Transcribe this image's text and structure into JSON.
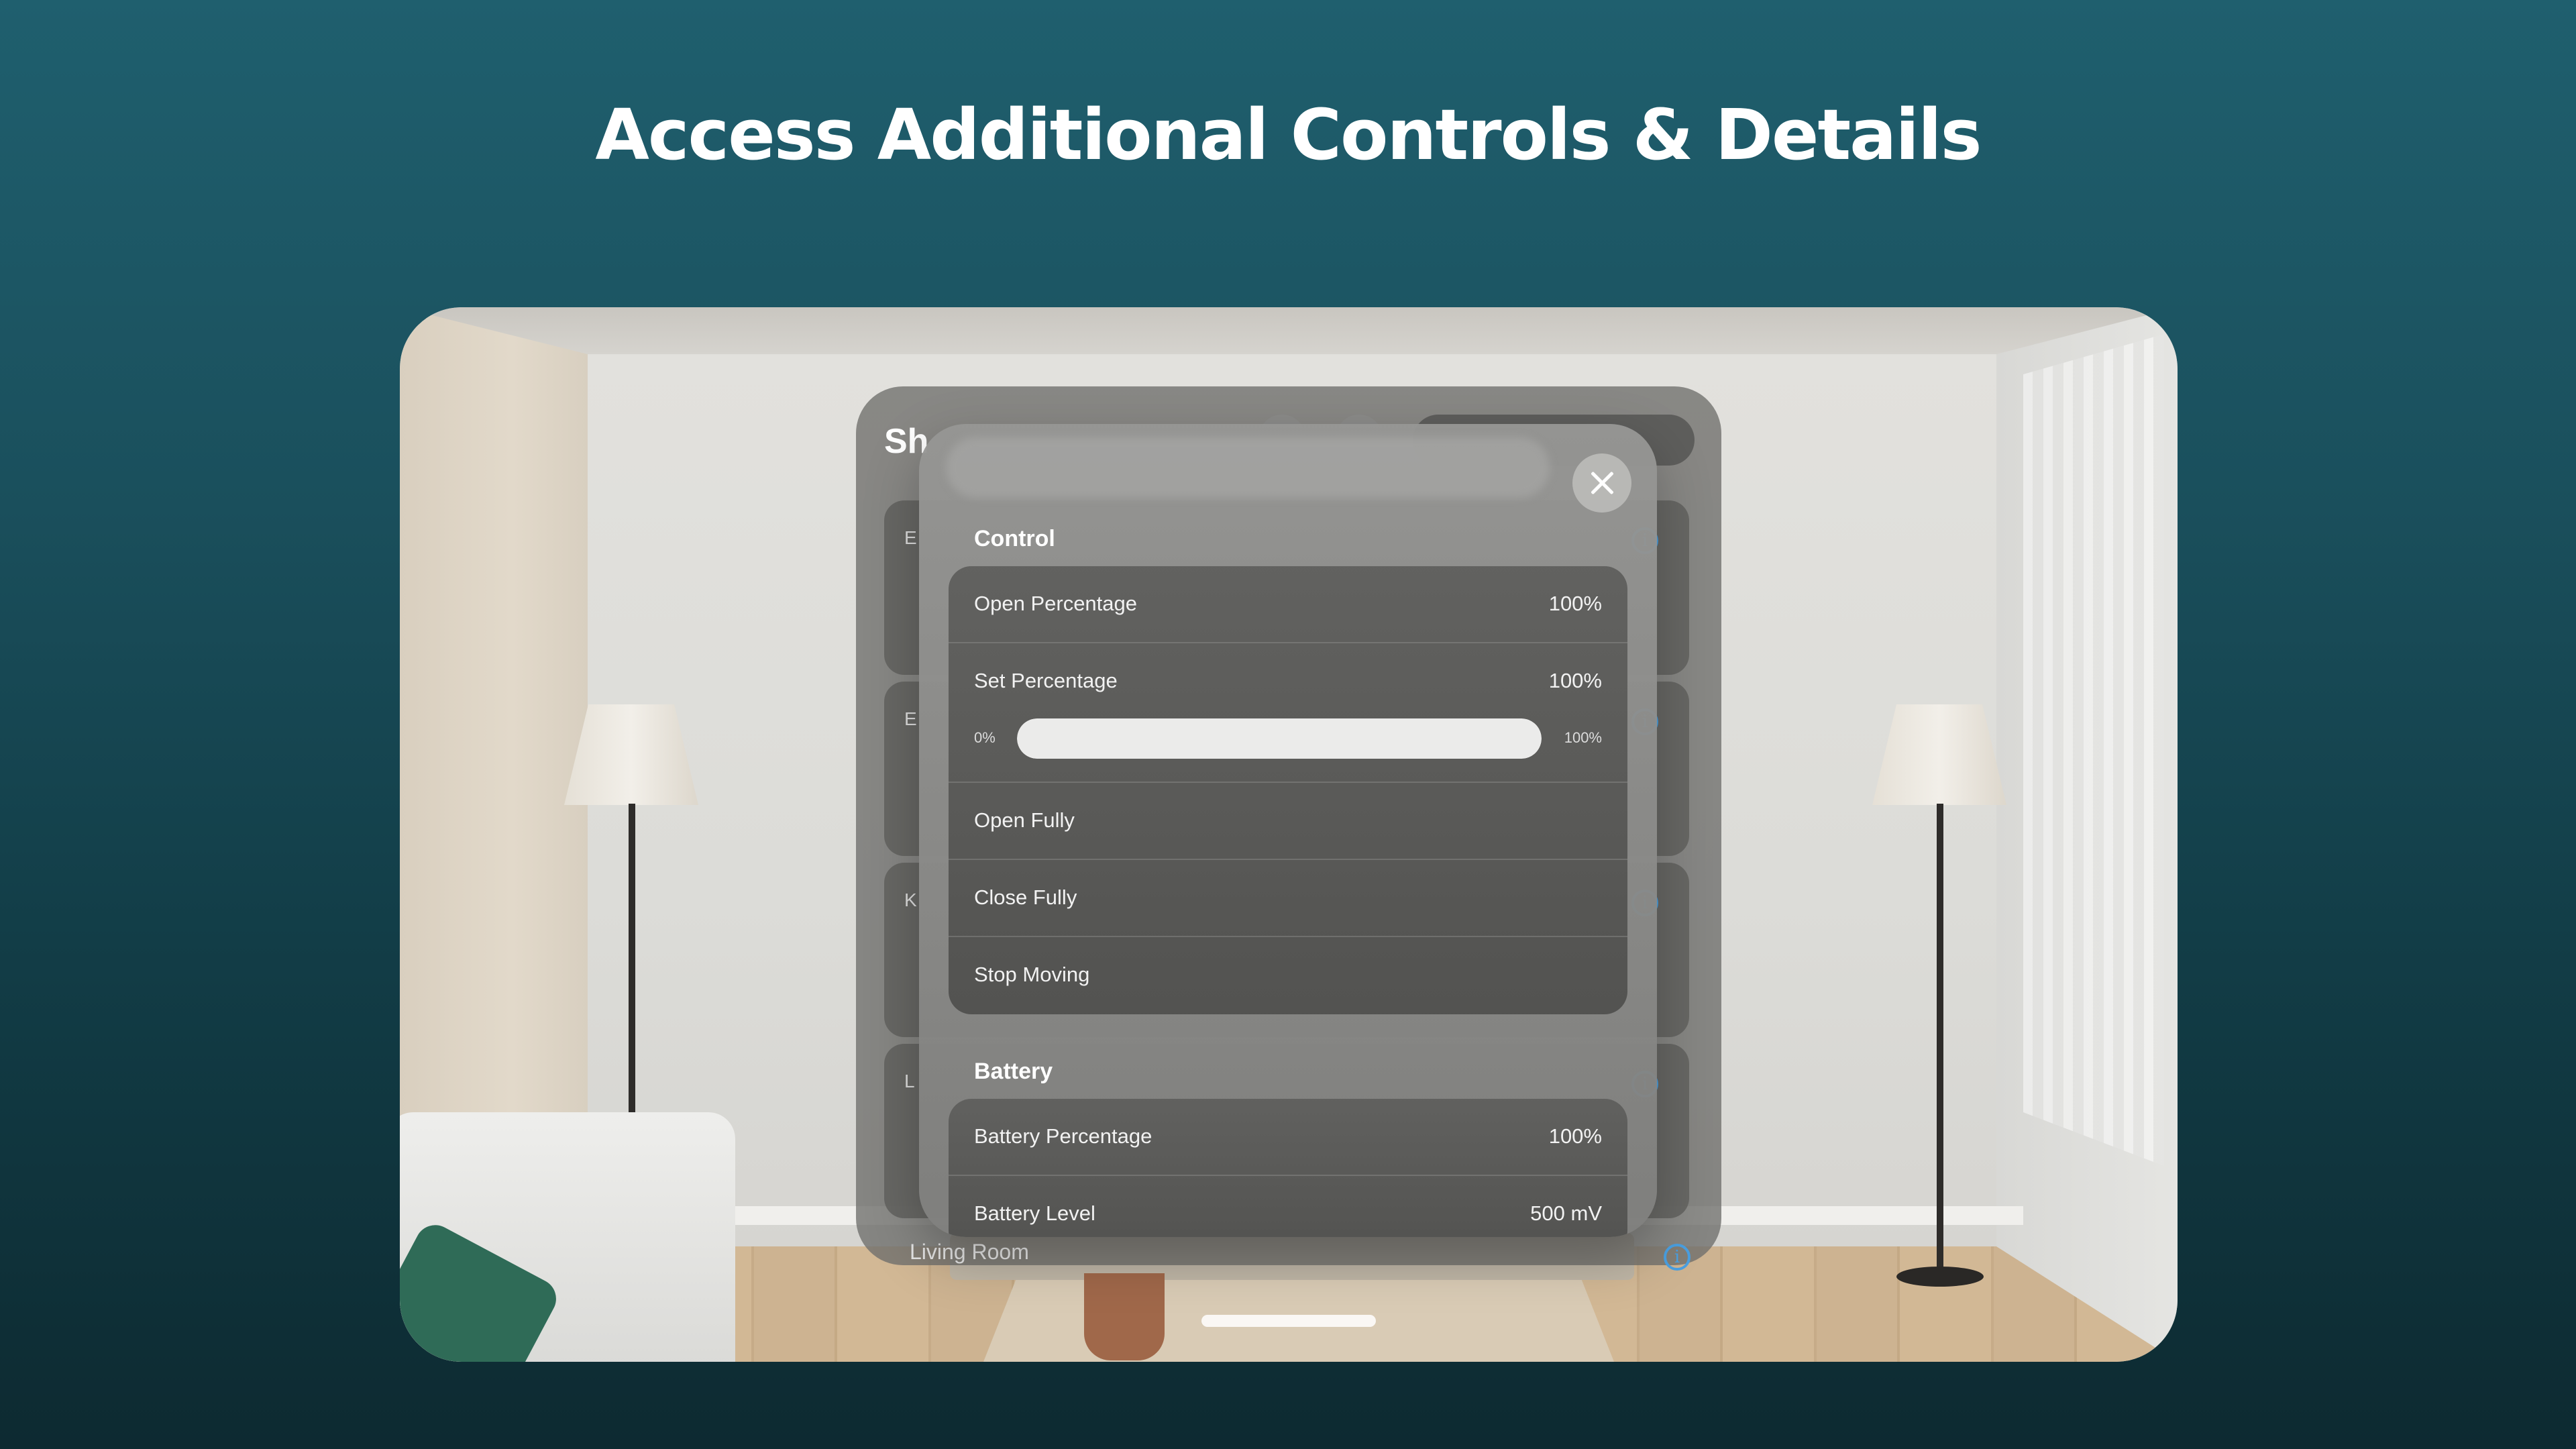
{
  "headline": "Access Additional Controls & Details",
  "background_window": {
    "title": "Sh",
    "card_letters": [
      "E",
      "E",
      "K",
      "L"
    ],
    "footer_room": "Living Room",
    "info_glyph": "i"
  },
  "sheet": {
    "close_icon": "close-icon",
    "control": {
      "title": "Control",
      "open_percentage": {
        "label": "Open Percentage",
        "value": "100%"
      },
      "set_percentage": {
        "label": "Set Percentage",
        "value": "100%",
        "slider_min": "0%",
        "slider_max": "100%",
        "slider_level": 1.0
      },
      "open_fully": "Open Fully",
      "close_fully": "Close Fully",
      "stop_moving": "Stop Moving"
    },
    "battery": {
      "title": "Battery",
      "battery_percentage": {
        "label": "Battery Percentage",
        "value": "100%"
      },
      "battery_level": {
        "label": "Battery Level",
        "value": "500 mV"
      }
    }
  },
  "colors": {
    "accent_info": "#4a9fe0",
    "background_top": "#1f5f6e",
    "background_bottom": "#0d2a31"
  }
}
